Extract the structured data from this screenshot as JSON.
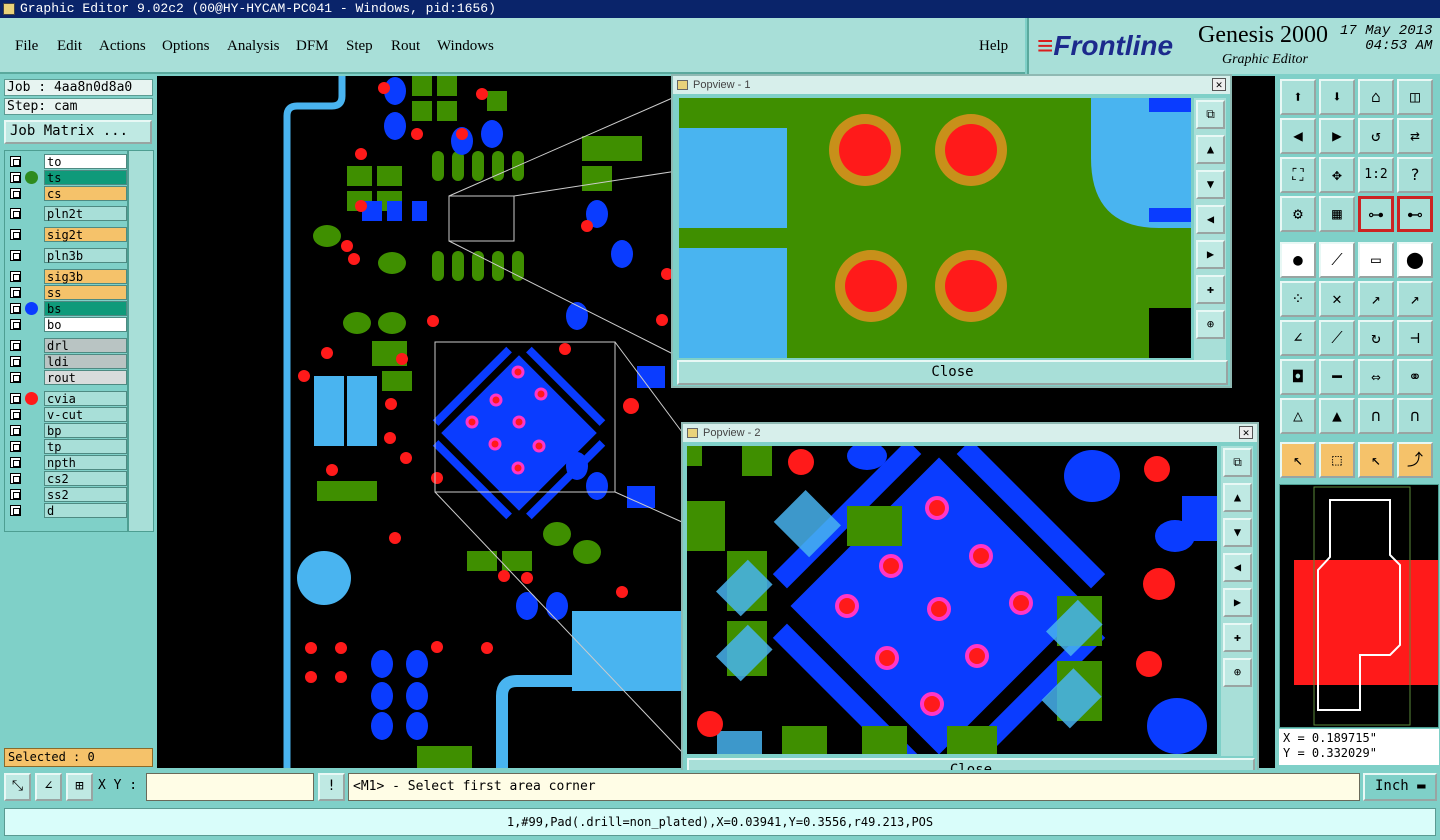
{
  "window": {
    "title": "Graphic Editor 9.02c2 (00@HY-HYCAM-PC041 - Windows, pid:1656)"
  },
  "menu": {
    "items": [
      "File",
      "Edit",
      "Actions",
      "Options",
      "Analysis",
      "DFM",
      "Step",
      "Rout",
      "Windows"
    ],
    "help": "Help"
  },
  "brand": {
    "logo": "Frontline",
    "product": "Genesis 2000",
    "subtitle": "Graphic Editor",
    "date": "17 May 2013",
    "time": "04:53 AM"
  },
  "job": {
    "job_label": "Job : 4aa8n0d8a0",
    "step_label": "Step: cam",
    "matrix_button": "Job Matrix ..."
  },
  "layers": [
    {
      "name": "to",
      "bg": "#ffffff",
      "dot": ""
    },
    {
      "name": "ts",
      "bg": "#0f9a7a",
      "dot": "#2e8b1e"
    },
    {
      "name": "cs",
      "bg": "#f5c26a",
      "dot": ""
    },
    {
      "name": "pln2t",
      "bg": "#a8dfd8",
      "dot": ""
    },
    {
      "name": "sig2t",
      "bg": "#f5c26a",
      "dot": ""
    },
    {
      "name": "pln3b",
      "bg": "#a8dfd8",
      "dot": ""
    },
    {
      "name": "sig3b",
      "bg": "#f5c26a",
      "dot": ""
    },
    {
      "name": "ss",
      "bg": "#f5c26a",
      "dot": ""
    },
    {
      "name": "bs",
      "bg": "#0f9a7a",
      "dot": "#0a3cff"
    },
    {
      "name": "bo",
      "bg": "#ffffff",
      "dot": ""
    },
    {
      "name": "drl",
      "bg": "#b9c4c3",
      "dot": ""
    },
    {
      "name": "ldi",
      "bg": "#b9c4c3",
      "dot": ""
    },
    {
      "name": "rout",
      "bg": "#d8dcdc",
      "dot": ""
    },
    {
      "name": "cvia",
      "bg": "#a8dfd8",
      "dot": "#ff1a1a"
    },
    {
      "name": "v-cut",
      "bg": "#a8dfd8",
      "dot": ""
    },
    {
      "name": "bp",
      "bg": "#a8dfd8",
      "dot": ""
    },
    {
      "name": "tp",
      "bg": "#a8dfd8",
      "dot": ""
    },
    {
      "name": "npth",
      "bg": "#a8dfd8",
      "dot": ""
    },
    {
      "name": "cs2",
      "bg": "#a8dfd8",
      "dot": ""
    },
    {
      "name": "ss2",
      "bg": "#a8dfd8",
      "dot": ""
    },
    {
      "name": "d",
      "bg": "#a8dfd8",
      "dot": ""
    }
  ],
  "selected": "Selected : 0",
  "popview1": {
    "title": "Popview - 1",
    "close": "Close"
  },
  "popview2": {
    "title": "Popview - 2",
    "close": "Close"
  },
  "coords": {
    "x": "X = 0.189715\"",
    "y": "Y = 0.332029\""
  },
  "bottom": {
    "xy_label": "X Y :",
    "xy_value": "",
    "prompt": "<M1> - Select first area corner",
    "units": "Inch",
    "status": "1,#99,Pad(.drill=non_plated),X=0.03941,Y=0.3556,r49.213,POS"
  },
  "colors": {
    "copper_green": "#3f8f00",
    "pad_blue": "#0a3cff",
    "light_blue": "#49b4f0",
    "via_red": "#ff1a1a",
    "panel_teal": "#7fd0c8"
  }
}
